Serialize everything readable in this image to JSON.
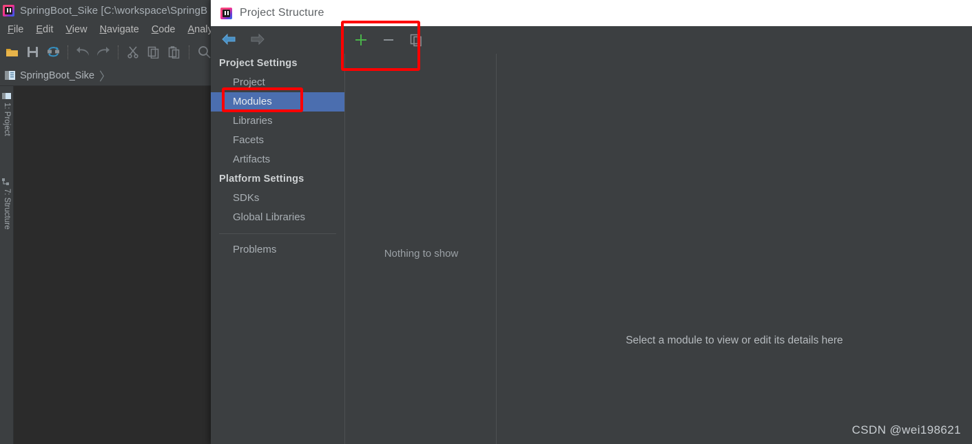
{
  "ide": {
    "title": "SpringBoot_Sike [C:\\workspace\\SpringB",
    "logo_icon": "intellij-idea-logo",
    "menu": [
      {
        "label": "File",
        "mnemonic": "F"
      },
      {
        "label": "Edit",
        "mnemonic": "E"
      },
      {
        "label": "View",
        "mnemonic": "V"
      },
      {
        "label": "Navigate",
        "mnemonic": "N"
      },
      {
        "label": "Code",
        "mnemonic": "C"
      },
      {
        "label": "Analyz",
        "mnemonic": "A"
      }
    ],
    "toolbar_icons": [
      "open-folder-icon",
      "save-all-icon",
      "sync-icon",
      "undo-icon",
      "redo-icon",
      "cut-icon",
      "copy-icon",
      "paste-icon",
      "search-icon"
    ],
    "breadcrumb": {
      "icon": "module-icon",
      "label": "SpringBoot_Sike",
      "separator": "〉"
    },
    "tool_rail": [
      {
        "label": "1: Project",
        "icon": "project-tool-icon"
      },
      {
        "label": "7: Structure",
        "icon": "structure-tool-icon"
      }
    ]
  },
  "dialog": {
    "title": "Project Structure",
    "logo_icon": "intellij-idea-logo",
    "nav": {
      "back_icon": "arrow-left-icon",
      "forward_icon": "arrow-right-icon",
      "back_enabled": "true",
      "forward_enabled": "false"
    },
    "sidebar": {
      "groups": [
        {
          "title": "Project Settings",
          "items": [
            {
              "label": "Project",
              "selected": false
            },
            {
              "label": "Modules",
              "selected": true
            },
            {
              "label": "Libraries",
              "selected": false
            },
            {
              "label": "Facets",
              "selected": false
            },
            {
              "label": "Artifacts",
              "selected": false
            }
          ]
        },
        {
          "title": "Platform Settings",
          "items": [
            {
              "label": "SDKs",
              "selected": false
            },
            {
              "label": "Global Libraries",
              "selected": false
            }
          ]
        }
      ],
      "footer_items": [
        {
          "label": "Problems",
          "selected": false
        }
      ]
    },
    "center": {
      "toolbar": [
        {
          "name": "add-button",
          "icon": "plus-icon",
          "color": "#4ab34a"
        },
        {
          "name": "remove-button",
          "icon": "minus-icon",
          "color": "#8b9095"
        },
        {
          "name": "copy-button",
          "icon": "copy-icon",
          "color": "#8b9095"
        }
      ],
      "empty_text": "Nothing to show"
    },
    "right": {
      "empty_text": "Select a module to view or edit its details here"
    }
  },
  "annotations": [
    {
      "name": "redbox-toolbar",
      "color": "#fe0000"
    },
    {
      "name": "redbox-modules",
      "color": "#fe0000"
    }
  ],
  "watermark": {
    "text": "CSDN @wei198621"
  },
  "colors": {
    "dialog_bg": "#3c3f41",
    "editor_bg": "#2b2b2b",
    "selection_blue": "#4b6eaf",
    "accent_red": "#fe0000",
    "add_green": "#4ab34a"
  }
}
